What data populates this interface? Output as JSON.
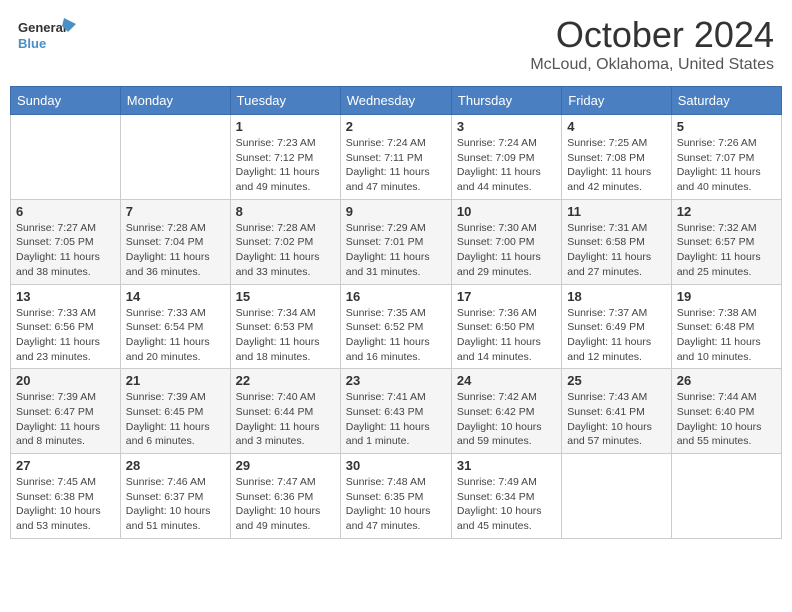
{
  "header": {
    "logo_line1": "General",
    "logo_line2": "Blue",
    "title": "October 2024",
    "subtitle": "McLoud, Oklahoma, United States"
  },
  "days_of_week": [
    "Sunday",
    "Monday",
    "Tuesday",
    "Wednesday",
    "Thursday",
    "Friday",
    "Saturday"
  ],
  "weeks": [
    [
      {
        "day": "",
        "info": ""
      },
      {
        "day": "",
        "info": ""
      },
      {
        "day": "1",
        "info": "Sunrise: 7:23 AM\nSunset: 7:12 PM\nDaylight: 11 hours and 49 minutes."
      },
      {
        "day": "2",
        "info": "Sunrise: 7:24 AM\nSunset: 7:11 PM\nDaylight: 11 hours and 47 minutes."
      },
      {
        "day": "3",
        "info": "Sunrise: 7:24 AM\nSunset: 7:09 PM\nDaylight: 11 hours and 44 minutes."
      },
      {
        "day": "4",
        "info": "Sunrise: 7:25 AM\nSunset: 7:08 PM\nDaylight: 11 hours and 42 minutes."
      },
      {
        "day": "5",
        "info": "Sunrise: 7:26 AM\nSunset: 7:07 PM\nDaylight: 11 hours and 40 minutes."
      }
    ],
    [
      {
        "day": "6",
        "info": "Sunrise: 7:27 AM\nSunset: 7:05 PM\nDaylight: 11 hours and 38 minutes."
      },
      {
        "day": "7",
        "info": "Sunrise: 7:28 AM\nSunset: 7:04 PM\nDaylight: 11 hours and 36 minutes."
      },
      {
        "day": "8",
        "info": "Sunrise: 7:28 AM\nSunset: 7:02 PM\nDaylight: 11 hours and 33 minutes."
      },
      {
        "day": "9",
        "info": "Sunrise: 7:29 AM\nSunset: 7:01 PM\nDaylight: 11 hours and 31 minutes."
      },
      {
        "day": "10",
        "info": "Sunrise: 7:30 AM\nSunset: 7:00 PM\nDaylight: 11 hours and 29 minutes."
      },
      {
        "day": "11",
        "info": "Sunrise: 7:31 AM\nSunset: 6:58 PM\nDaylight: 11 hours and 27 minutes."
      },
      {
        "day": "12",
        "info": "Sunrise: 7:32 AM\nSunset: 6:57 PM\nDaylight: 11 hours and 25 minutes."
      }
    ],
    [
      {
        "day": "13",
        "info": "Sunrise: 7:33 AM\nSunset: 6:56 PM\nDaylight: 11 hours and 23 minutes."
      },
      {
        "day": "14",
        "info": "Sunrise: 7:33 AM\nSunset: 6:54 PM\nDaylight: 11 hours and 20 minutes."
      },
      {
        "day": "15",
        "info": "Sunrise: 7:34 AM\nSunset: 6:53 PM\nDaylight: 11 hours and 18 minutes."
      },
      {
        "day": "16",
        "info": "Sunrise: 7:35 AM\nSunset: 6:52 PM\nDaylight: 11 hours and 16 minutes."
      },
      {
        "day": "17",
        "info": "Sunrise: 7:36 AM\nSunset: 6:50 PM\nDaylight: 11 hours and 14 minutes."
      },
      {
        "day": "18",
        "info": "Sunrise: 7:37 AM\nSunset: 6:49 PM\nDaylight: 11 hours and 12 minutes."
      },
      {
        "day": "19",
        "info": "Sunrise: 7:38 AM\nSunset: 6:48 PM\nDaylight: 11 hours and 10 minutes."
      }
    ],
    [
      {
        "day": "20",
        "info": "Sunrise: 7:39 AM\nSunset: 6:47 PM\nDaylight: 11 hours and 8 minutes."
      },
      {
        "day": "21",
        "info": "Sunrise: 7:39 AM\nSunset: 6:45 PM\nDaylight: 11 hours and 6 minutes."
      },
      {
        "day": "22",
        "info": "Sunrise: 7:40 AM\nSunset: 6:44 PM\nDaylight: 11 hours and 3 minutes."
      },
      {
        "day": "23",
        "info": "Sunrise: 7:41 AM\nSunset: 6:43 PM\nDaylight: 11 hours and 1 minute."
      },
      {
        "day": "24",
        "info": "Sunrise: 7:42 AM\nSunset: 6:42 PM\nDaylight: 10 hours and 59 minutes."
      },
      {
        "day": "25",
        "info": "Sunrise: 7:43 AM\nSunset: 6:41 PM\nDaylight: 10 hours and 57 minutes."
      },
      {
        "day": "26",
        "info": "Sunrise: 7:44 AM\nSunset: 6:40 PM\nDaylight: 10 hours and 55 minutes."
      }
    ],
    [
      {
        "day": "27",
        "info": "Sunrise: 7:45 AM\nSunset: 6:38 PM\nDaylight: 10 hours and 53 minutes."
      },
      {
        "day": "28",
        "info": "Sunrise: 7:46 AM\nSunset: 6:37 PM\nDaylight: 10 hours and 51 minutes."
      },
      {
        "day": "29",
        "info": "Sunrise: 7:47 AM\nSunset: 6:36 PM\nDaylight: 10 hours and 49 minutes."
      },
      {
        "day": "30",
        "info": "Sunrise: 7:48 AM\nSunset: 6:35 PM\nDaylight: 10 hours and 47 minutes."
      },
      {
        "day": "31",
        "info": "Sunrise: 7:49 AM\nSunset: 6:34 PM\nDaylight: 10 hours and 45 minutes."
      },
      {
        "day": "",
        "info": ""
      },
      {
        "day": "",
        "info": ""
      }
    ]
  ]
}
